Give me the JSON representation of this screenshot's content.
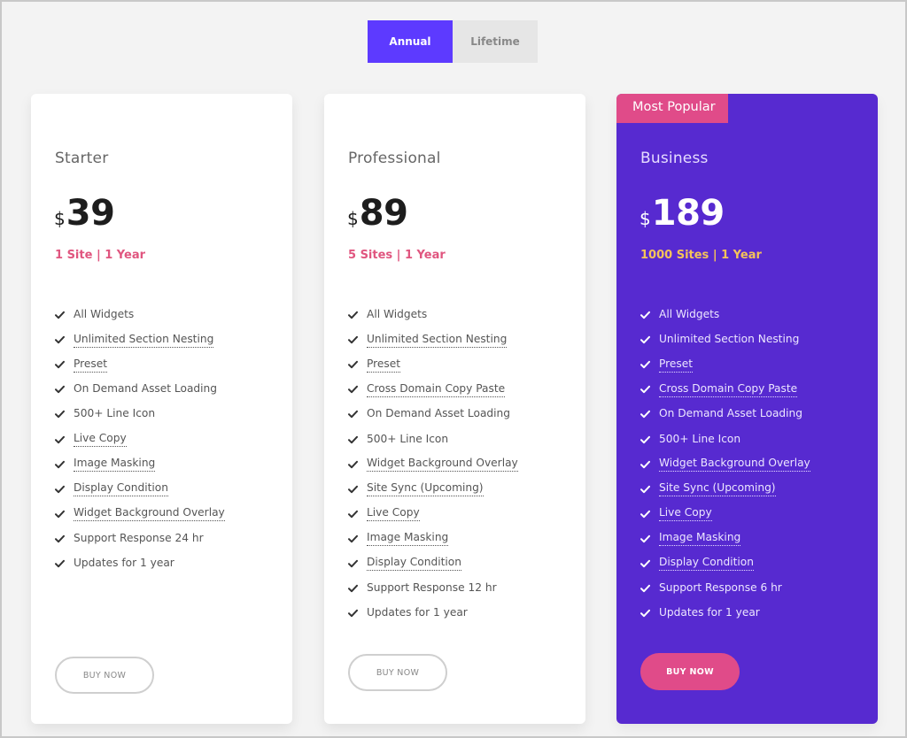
{
  "billing_toggle": {
    "options": [
      {
        "label": "Annual",
        "active": true
      },
      {
        "label": "Lifetime",
        "active": false
      }
    ],
    "active_color": "#5d3aff"
  },
  "plans": [
    {
      "name": "Starter",
      "currency": "$",
      "price": "39",
      "sites": "1 Site | 1 Year",
      "features": [
        {
          "text": "All Widgets",
          "tooltip": false
        },
        {
          "text": "Unlimited Section Nesting",
          "tooltip": true
        },
        {
          "text": "Preset",
          "tooltip": true
        },
        {
          "text": "On Demand Asset Loading",
          "tooltip": false
        },
        {
          "text": "500+ Line Icon",
          "tooltip": false
        },
        {
          "text": "Live Copy",
          "tooltip": true
        },
        {
          "text": "Image Masking",
          "tooltip": true
        },
        {
          "text": "Display Condition",
          "tooltip": true
        },
        {
          "text": "Widget Background Overlay",
          "tooltip": true
        },
        {
          "text": "Support Response 24 hr",
          "tooltip": false
        },
        {
          "text": "Updates for 1 year",
          "tooltip": false
        }
      ],
      "button_label": "BUY NOW"
    },
    {
      "name": "Professional",
      "currency": "$",
      "price": "89",
      "sites": "5 Sites | 1 Year",
      "features": [
        {
          "text": "All Widgets",
          "tooltip": false
        },
        {
          "text": "Unlimited Section Nesting",
          "tooltip": true
        },
        {
          "text": "Preset",
          "tooltip": true
        },
        {
          "text": "Cross Domain Copy Paste",
          "tooltip": true
        },
        {
          "text": "On Demand Asset Loading",
          "tooltip": false
        },
        {
          "text": "500+ Line Icon",
          "tooltip": false
        },
        {
          "text": "Widget Background Overlay",
          "tooltip": true
        },
        {
          "text": "Site Sync (Upcoming)",
          "tooltip": true
        },
        {
          "text": "Live Copy",
          "tooltip": true
        },
        {
          "text": "Image Masking",
          "tooltip": true
        },
        {
          "text": "Display Condition",
          "tooltip": true
        },
        {
          "text": "Support Response 12 hr",
          "tooltip": false
        },
        {
          "text": "Updates for 1 year",
          "tooltip": false
        }
      ],
      "button_label": "BUY NOW"
    },
    {
      "name": "Business",
      "badge": "Most Popular",
      "currency": "$",
      "price": "189",
      "sites": "1000 Sites | 1 Year",
      "highlight_color": "#572ad0",
      "features": [
        {
          "text": "All Widgets",
          "tooltip": false
        },
        {
          "text": "Unlimited Section Nesting",
          "tooltip": false
        },
        {
          "text": "Preset",
          "tooltip": true
        },
        {
          "text": "Cross Domain Copy Paste",
          "tooltip": true
        },
        {
          "text": "On Demand Asset Loading",
          "tooltip": false
        },
        {
          "text": "500+ Line Icon",
          "tooltip": false
        },
        {
          "text": "Widget Background Overlay",
          "tooltip": true
        },
        {
          "text": "Site Sync (Upcoming)",
          "tooltip": true
        },
        {
          "text": "Live Copy",
          "tooltip": true
        },
        {
          "text": "Image Masking",
          "tooltip": true
        },
        {
          "text": "Display Condition",
          "tooltip": true
        },
        {
          "text": "Support Response 6 hr",
          "tooltip": false
        },
        {
          "text": "Updates for 1 year",
          "tooltip": false
        }
      ],
      "button_label": "BUY NOW"
    }
  ],
  "icons": {
    "feature_bullet": "check-icon"
  }
}
